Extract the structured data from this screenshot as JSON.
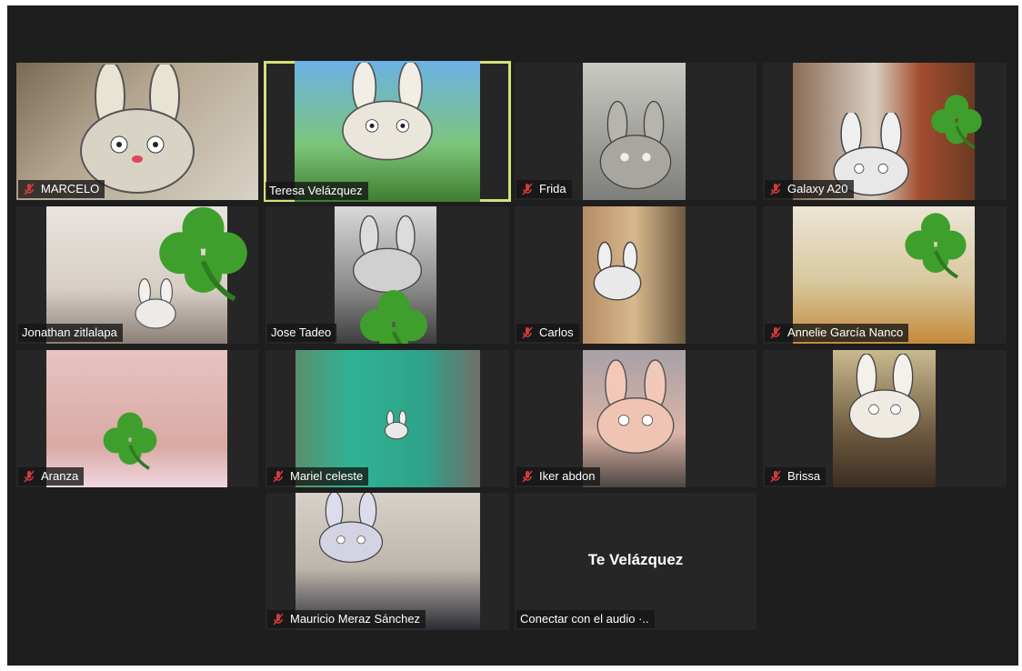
{
  "colors": {
    "background": "#1e1e1e",
    "tile": "#262626",
    "active_border": "#d6df7a",
    "mute_red": "#d23b3b",
    "clover": "#3f9f2c"
  },
  "participants": [
    {
      "name": "MARCELO",
      "muted": true
    },
    {
      "name": "Teresa Velázquez",
      "muted": false,
      "active_speaker": true
    },
    {
      "name": "Frida",
      "muted": true
    },
    {
      "name": "Galaxy A20",
      "muted": true
    },
    {
      "name": "Jonathan zitlalapa",
      "muted": false
    },
    {
      "name": "Jose Tadeo",
      "muted": false
    },
    {
      "name": "Carlos",
      "muted": true
    },
    {
      "name": "Annelie García Nanco",
      "muted": true
    },
    {
      "name": "Aranza",
      "muted": true
    },
    {
      "name": "Mariel celeste",
      "muted": true
    },
    {
      "name": "Iker abdon",
      "muted": true
    },
    {
      "name": "Brissa",
      "muted": true
    },
    {
      "name": "Mauricio Meraz Sánchez",
      "muted": true
    }
  ],
  "audio_only": {
    "name": "Te Velázquez",
    "status": "Conectar con el audio ·.."
  },
  "icons": {
    "mute": "microphone-muted-icon",
    "sticker": "clover-icon"
  }
}
